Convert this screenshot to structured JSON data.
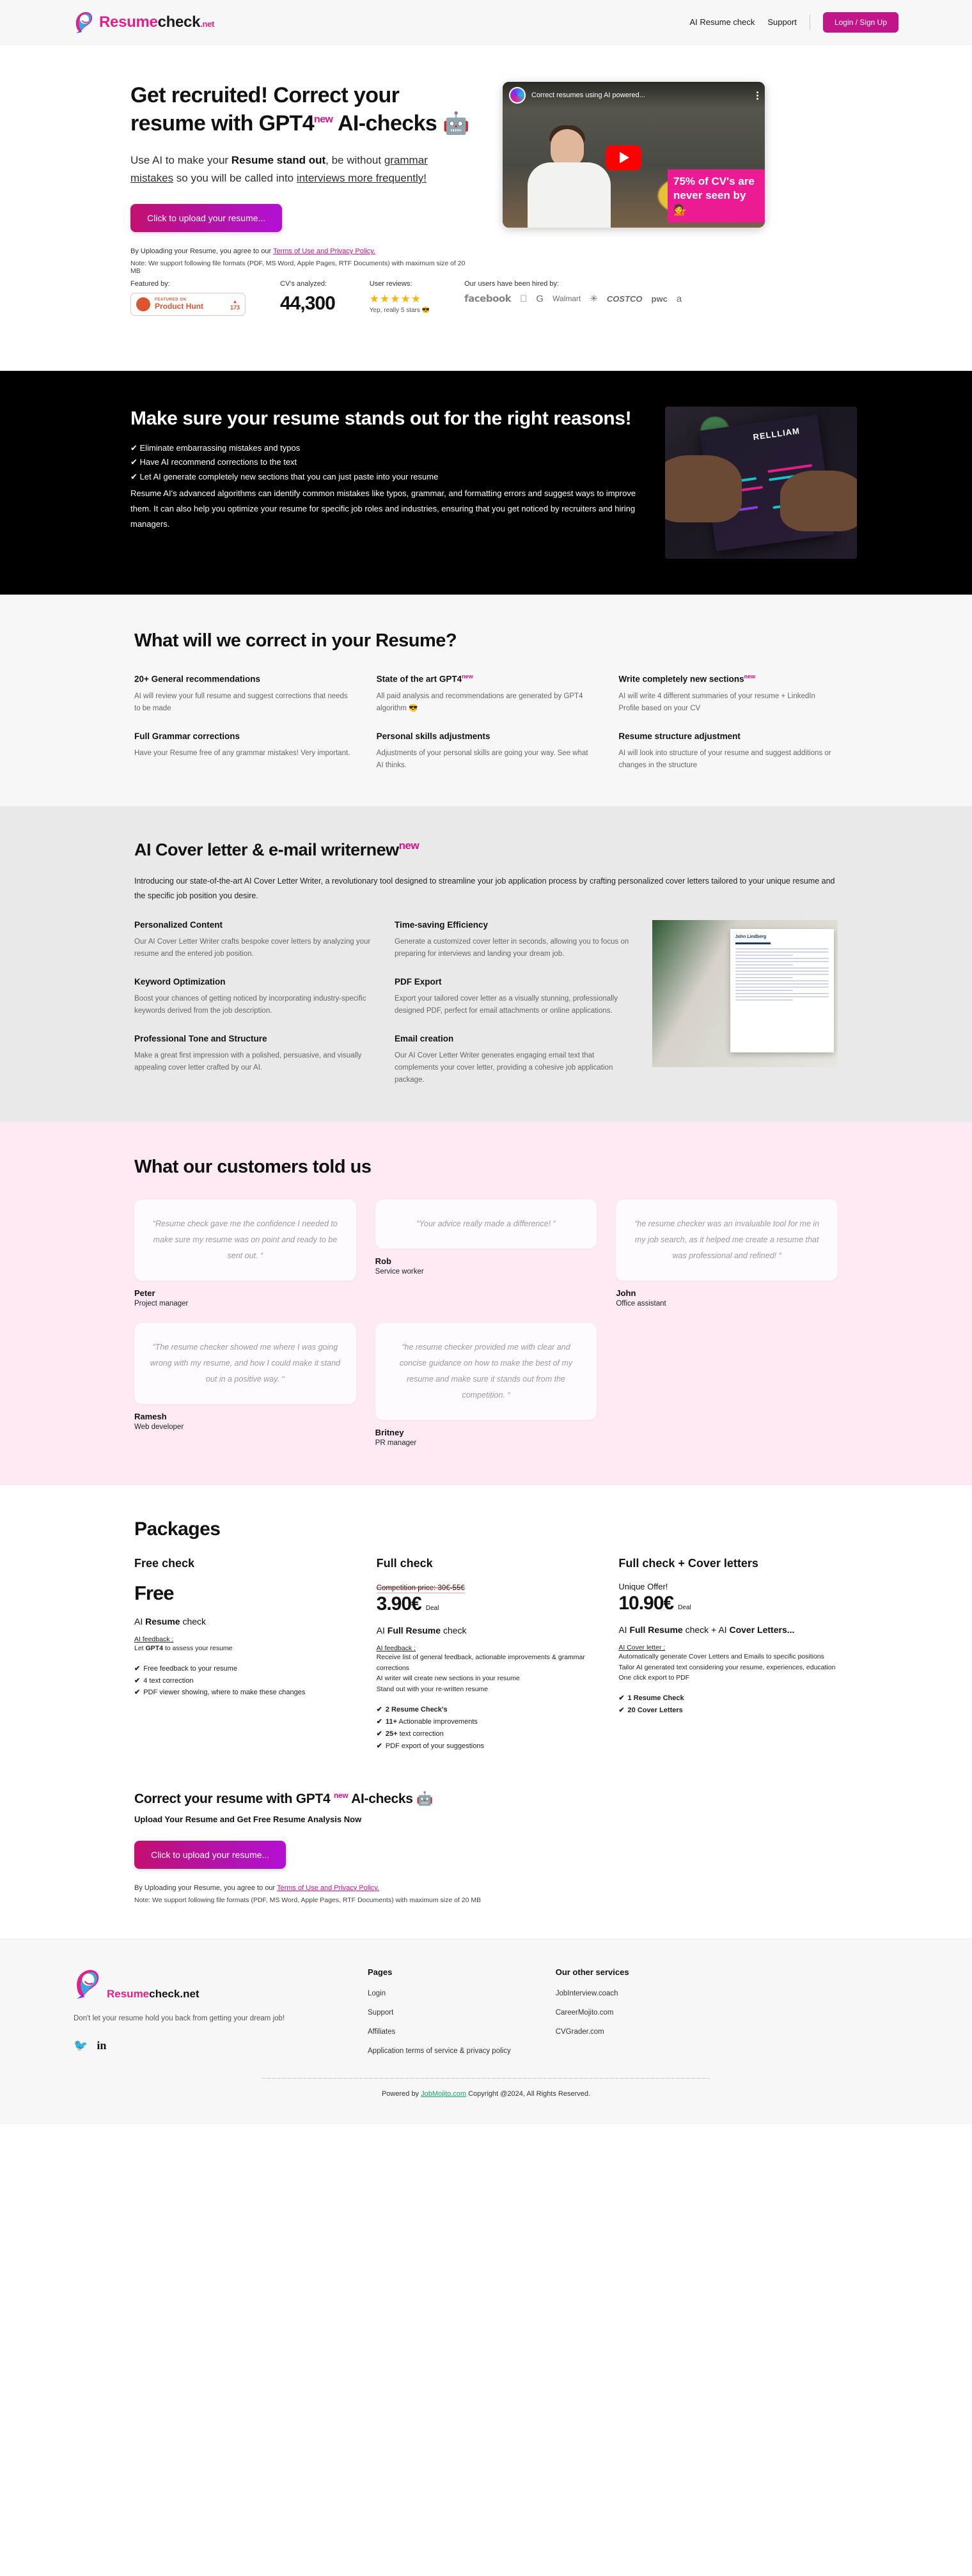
{
  "header": {
    "brand": {
      "part1": "Resume",
      "part2": "check",
      "tld": ".net"
    },
    "nav": [
      {
        "label": "AI Resume check"
      },
      {
        "label": "Support"
      }
    ],
    "login_label": "Login / Sign Up"
  },
  "hero": {
    "title_a": "Get recruited! Correct your resume with GPT4",
    "title_new": "new",
    "title_b": " AI-checks 🤖",
    "sub_a": "Use AI to make your ",
    "sub_bold": "Resume stand out",
    "sub_b": ", be without ",
    "sub_u1": "grammar mistakes",
    "sub_c": " so you will be called into ",
    "sub_u2": "interviews more frequently!",
    "upload_button": "Click to upload your resume...",
    "terms_prefix": "By Uploading your Resume, you agree to our ",
    "terms_link": "Terms of Use and Privacy Policy.",
    "note": "Note: We support following file formats (PDF, MS Word, Apple Pages, RTF Documents) with maximum size of 20 MB",
    "video": {
      "title": "Correct resumes using AI powered...",
      "caption": "75% of CV's are never seen by 💁"
    }
  },
  "proof": {
    "featured_label": "Featured by:",
    "product_hunt": {
      "small": "FEATURED ON",
      "name": "Product Hunt",
      "arrow": "▲",
      "count": "173"
    },
    "cv_label": "CV's analyzed:",
    "cv_count": "44,300",
    "reviews_label": "User reviews:",
    "stars": "★★★★★",
    "stars_note": "Yep, really 5 stars 😎",
    "hired_label": "Our users have been hired by:",
    "hired_logos": [
      "facebook",
      "",
      "G",
      "Walmart",
      "COSTCO",
      "pwc",
      "a"
    ]
  },
  "band": {
    "title": "Make sure your resume stands out for the right reasons!",
    "bullets": [
      "✔ Eliminate embarrassing mistakes and typos",
      "✔ Have AI recommend corrections to the text",
      "✔ Let AI generate completely new sections that you can just paste into your resume"
    ],
    "paragraph": "Resume AI's advanced algorithms can identify common mistakes like typos, grammar, and formatting errors and suggest ways to improve them. It can also help you optimize your resume for specific job roles and industries, ensuring that you get noticed by recruiters and hiring managers.",
    "photo_name": "RELLLIAM"
  },
  "correct": {
    "title": "What will we correct in your Resume?",
    "features": [
      {
        "title": "20+ General recommendations",
        "new": "",
        "body": "AI will review your full resume and suggest corrections that needs to be made"
      },
      {
        "title": "State of the art GPT4",
        "new": "new",
        "body": "All paid analysis and recommendations are generated by GPT4 algorithm 😎"
      },
      {
        "title": "Write completely new sections",
        "new": "new",
        "body": "AI will write 4 different summaries of your resume + LinkedIn Profile based on your CV"
      },
      {
        "title": "Full Grammar corrections",
        "new": "",
        "body": "Have your Resume free of any grammar mistakes! Very important."
      },
      {
        "title": "Personal skills adjustments",
        "new": "",
        "body": "Adjustments of your personal skills are going your way. See what AI thinks."
      },
      {
        "title": "Resume structure adjustment",
        "new": "",
        "body": "AI will look into structure of your resume and suggest additions or changes in the structure"
      }
    ]
  },
  "cover": {
    "title": "AI Cover letter & e-mail writernew",
    "title_new": "new",
    "intro": "Introducing our state-of-the-art AI Cover Letter Writer, a revolutionary tool designed to streamline your job application process by crafting personalized cover letters tailored to your unique resume and the specific job position you desire.",
    "features": [
      {
        "title": "Personalized Content",
        "body": "Our AI Cover Letter Writer crafts bespoke cover letters by analyzing your resume and the entered job position."
      },
      {
        "title": "Time-saving Efficiency",
        "body": "Generate a customized cover letter in seconds, allowing you to focus on preparing for interviews and landing your dream job."
      },
      {
        "title": "Keyword Optimization",
        "body": "Boost your chances of getting noticed by incorporating industry-specific keywords derived from the job description."
      },
      {
        "title": "PDF Export",
        "body": "Export your tailored cover letter as a visually stunning, professionally designed PDF, perfect for email attachments or online applications."
      },
      {
        "title": "Professional Tone and Structure",
        "body": "Make a great first impression with a polished, persuasive, and visually appealing cover letter crafted by our AI."
      },
      {
        "title": "Email creation",
        "body": "Our AI Cover Letter Writer generates engaging email text that complements your cover letter, providing a cohesive job application package."
      }
    ],
    "letter_name": "John Lindberg"
  },
  "testimonials": {
    "title": "What our customers told us",
    "items": [
      {
        "quote": "“Resume check gave me the confidence I needed to make sure my resume was on point and ready to be sent out. “",
        "name": "Peter",
        "role": "Project manager"
      },
      {
        "quote": "“Your advice really made a difference! “",
        "name": "Rob",
        "role": "Service worker"
      },
      {
        "quote": "“he resume checker was an invaluable tool for me in my job search, as it helped me create a resume that was professional and refined! “",
        "name": "John",
        "role": "Office assistant"
      },
      {
        "quote": "“The resume checker showed me where I was going wrong with my resume, and how I could make it stand out in a positive way. “",
        "name": "Ramesh",
        "role": "Web developer"
      },
      {
        "quote": "“he resume checker provided me with clear and concise guidance on how to make the best of my resume and make sure it stands out from the competition. “",
        "name": "Britney",
        "role": "PR manager"
      }
    ]
  },
  "packages": {
    "title": "Packages",
    "free": {
      "name": "Free check",
      "price": "Free",
      "sub_a": "AI ",
      "sub_b": "Resume",
      "sub_c": " check",
      "fb_label": "AI feedback :",
      "fb_lines": [
        "Let GPT4 to assess your resume"
      ],
      "checks": [
        {
          "bold": "",
          "text": "Free feedback to your resume"
        },
        {
          "bold": "",
          "text": "4 text correction"
        },
        {
          "bold": "",
          "text": "PDF viewer showing, where to make these changes"
        }
      ]
    },
    "full": {
      "name": "Full check",
      "competition": "Competition price: 30€-55€",
      "price": "3.90€",
      "deal": "Deal",
      "sub_a": "AI ",
      "sub_b": "Full Resume",
      "sub_c": " check",
      "fb_label": "AI feedback :",
      "fb_lines": [
        "Receive list of general feedback, actionable improvements & grammar corrections",
        "AI writer will create new sections in your resume",
        "Stand out with your re-written resume"
      ],
      "checks": [
        {
          "bold": "2 Resume Check's",
          "text": ""
        },
        {
          "bold": "11+",
          "text": " Actionable improvements"
        },
        {
          "bold": "25+",
          "text": " text correction"
        },
        {
          "bold": "",
          "text": "PDF export of your suggestions"
        }
      ]
    },
    "combo": {
      "name": "Full check + Cover letters",
      "unique": "Unique Offer!",
      "price": "10.90€",
      "deal": "Deal",
      "sub_a": "AI ",
      "sub_b": "Full Resume",
      "sub_c": " check + AI ",
      "sub_d": "Cover Letters...",
      "fb_label": "AI Cover letter :",
      "fb_lines": [
        "Automatically generate Cover Letters and Emails to specific positions",
        "Tailor AI generated text considering your resume, experiences, education",
        "One click export to PDF"
      ],
      "checks": [
        {
          "bold": "1 Resume Check",
          "text": ""
        },
        {
          "bold": "20 Cover Letters",
          "text": ""
        }
      ]
    }
  },
  "final_cta": {
    "title_a": "Correct your resume with GPT4",
    "title_new": "new",
    "title_b": " AI-checks 🤖",
    "subtitle": "Upload Your Resume and Get Free Resume Analysis Now",
    "button": "Click to upload your resume...",
    "terms_prefix": "By Uploading your Resume, you agree to our ",
    "terms_link": "Terms of Use and Privacy Policy.",
    "note": "Note: We support following file formats (PDF, MS Word, Apple Pages, RTF Documents) with maximum size of 20 MB"
  },
  "footer": {
    "brand": {
      "part1": "Resume",
      "part2": "check.net"
    },
    "tagline": "Don't let your resume hold you back from getting your dream job!",
    "socials": [
      "twitter-icon",
      "linkedin-icon"
    ],
    "pages": {
      "heading": "Pages",
      "links": [
        "Login",
        "Support",
        "Affiliates",
        "Application terms of service & privacy policy"
      ]
    },
    "services": {
      "heading": "Our other services",
      "links": [
        "JobInterview.coach",
        "CareerMojito.com",
        "CVGrader.com"
      ]
    },
    "powered_prefix": "Powered by ",
    "powered_link": "JobMojito.com",
    "copyright": " Copyright @2024, All Rights Reserved."
  }
}
